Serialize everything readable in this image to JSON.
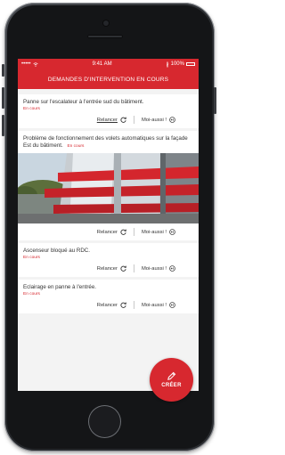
{
  "statusbar": {
    "signal": "••••• ",
    "time": "9:41 AM",
    "battery": "100%"
  },
  "header": {
    "title": "DEMANDES D'INTERVENTION EN COURS"
  },
  "requests": [
    {
      "title": "Panne sur l'escalateur à l'entrée sud du bâtiment.",
      "status": "En cours"
    },
    {
      "title": "Problème de fonctionnement des volets automatiques sur la façade Est du bâtiment.",
      "status": "En cours"
    },
    {
      "title": "Ascenseur bloqué au RDC.",
      "status": "En cours"
    },
    {
      "title": "Eclairage en panne à l'entrée.",
      "status": "En cours"
    }
  ],
  "actions": {
    "relancer": "Relancer",
    "moi_aussi": "Moi-aussi !"
  },
  "fab": {
    "label": "CRÉER"
  }
}
